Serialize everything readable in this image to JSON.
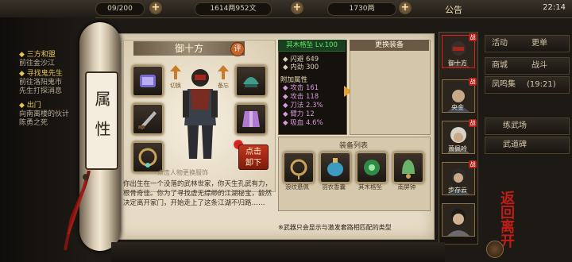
{
  "topbar": {
    "resource1": "09/200",
    "resource2": "1614两952文",
    "resource3": "1730两",
    "notice": "公告",
    "clock": "22:14",
    "plus": "+"
  },
  "left_quests": [
    {
      "title": "◆ 三方和盟",
      "sub": "前往金沙江"
    },
    {
      "title": "◆ 寻找鬼先生",
      "sub": "前往洛阳鬼市"
    },
    {
      "title": "",
      "sub": "先生打探消息"
    },
    {
      "title": "◆ 出门",
      "sub": "向南离楼的伙计"
    },
    {
      "title": "",
      "sub": "陈勇之死"
    }
  ],
  "scroll_label": "属性",
  "character": {
    "name": "御十方",
    "eval_badge": "评",
    "hint": "点击人物更换服饰",
    "desc": "你出生在一个没落的武林世家，你天生孔武有力，根骨奇佳。你为了寻找虚无缥缈的江湖秘宝，毅然决定离开家门，开始走上了这条江湖不归路……",
    "left_swap_label": "切换",
    "right_swap_label": "备忘",
    "unload_btn": "点击\n卸下"
  },
  "item": {
    "name": "其木格坠 Lv.100",
    "base_stats": [
      {
        "label": "◆ 闪避",
        "value": "649"
      },
      {
        "label": "◆ 内劲",
        "value": "300"
      }
    ],
    "extra_heading": "附加属性",
    "extra_stats": [
      {
        "label": "◆ 攻击",
        "value": "161"
      },
      {
        "label": "◆ 攻击",
        "value": "118"
      },
      {
        "label": "◆ 刀法",
        "value": "2.3%"
      },
      {
        "label": "◆ 臂力",
        "value": "12"
      },
      {
        "label": "◆ 吸血",
        "value": "4.6%"
      }
    ]
  },
  "replace_header": "更换装备",
  "equip_list": {
    "header": "装备列表",
    "items": [
      "浪纹悬佩",
      "羽衣香囊",
      "其木格坠",
      "南屏钟"
    ]
  },
  "footnote": "※武器只会显示与激发套路相匹配的类型",
  "party": [
    {
      "name": "御十方",
      "tag": "战"
    },
    {
      "name": "央金",
      "tag": "战"
    },
    {
      "name": "萧佩吟",
      "tag": "战"
    },
    {
      "name": "步存云",
      "tag": "战"
    }
  ],
  "right_menu": [
    {
      "label": "活动",
      "value": "更单"
    },
    {
      "label": "商城",
      "value": "战斗"
    },
    {
      "label": "凤鸣集",
      "value": "(19:21)"
    },
    {
      "label": "",
      "value": "练武场"
    },
    {
      "label": "",
      "value": "武道碑"
    }
  ],
  "back_btn": "返回离开",
  "colors": {
    "accent_green": "#63e46a",
    "accent_red": "#c01d15",
    "paper": "#e6dcc6"
  }
}
